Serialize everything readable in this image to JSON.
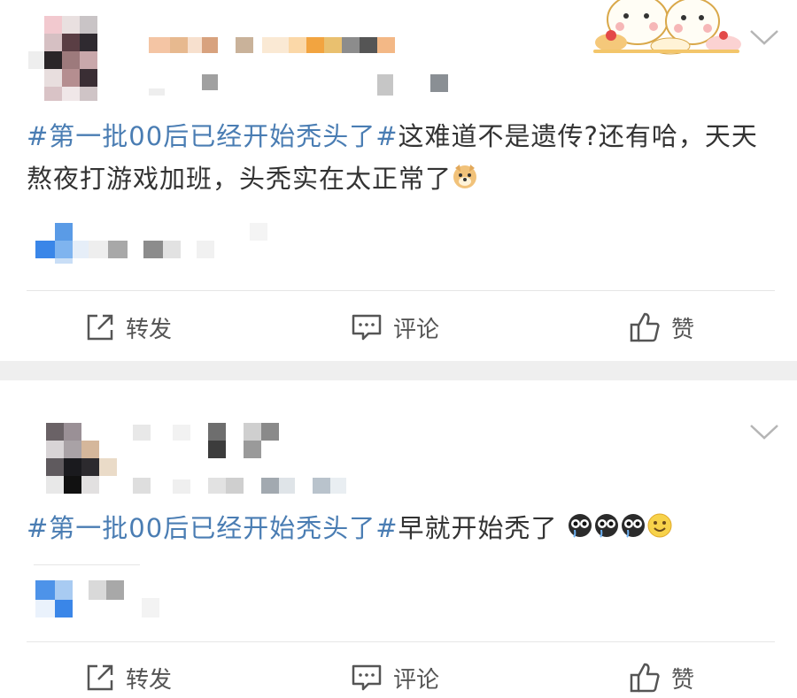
{
  "posts": [
    {
      "text_hashtag": "#第一批00后已经开始秃头了#",
      "text_body": "这难道不是遗传?还有哈，天天熬夜打游戏加班，头秃实在太正常了",
      "actions": {
        "repost": "转发",
        "comment": "评论",
        "like": "赞"
      },
      "emoji_end": "doge-emoji"
    },
    {
      "text_hashtag": "#第一批00后已经开始秃头了#",
      "text_body": "早就开始秃了",
      "actions": {
        "repost": "转发",
        "comment": "评论",
        "like": "赞"
      },
      "emojis": [
        "crying-emoji",
        "crying-emoji",
        "crying-emoji",
        "smile-emoji"
      ]
    }
  ],
  "colors": {
    "hashtag": "#4a7db3",
    "body": "#333333",
    "separator": "#efefef",
    "accent_blue": "#3a86e8"
  },
  "icons": [
    "chevron-down-icon",
    "repost-icon",
    "comment-icon",
    "like-icon"
  ]
}
